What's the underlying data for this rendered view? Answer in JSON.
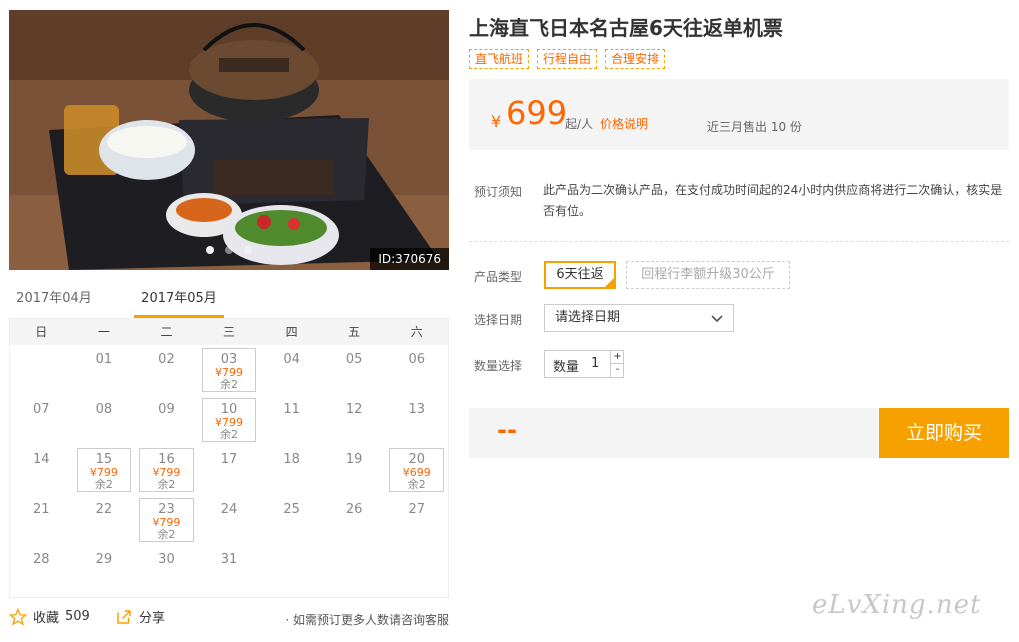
{
  "product": {
    "title": "上海直飞日本名古屋6天往返单机票",
    "tags": [
      "直飞航班",
      "行程自由",
      "合理安排"
    ],
    "photo_id": "ID:370676"
  },
  "price": {
    "currency": "¥",
    "amount": "699",
    "per": "起/人",
    "note_link": "价格说明",
    "sold": "近三月售出 10 份"
  },
  "booking": {
    "notice_label": "预订须知",
    "notice_text": "此产品为二次确认产品，在支付成功时间起的24小时内供应商将进行二次确认，核实是否有位。",
    "type_label": "产品类型",
    "type_selected": "6天往返",
    "type_alt": "回程行李额升级30公斤",
    "date_label": "选择日期",
    "date_placeholder": "请选择日期",
    "qty_label_row": "数量选择",
    "qty_label": "数量",
    "qty_value": "1",
    "qty_plus": "+",
    "qty_minus": "-"
  },
  "buy": {
    "total": "--",
    "button": "立即购买"
  },
  "calendar": {
    "tabs": [
      "2017年04月",
      "2017年05月"
    ],
    "active_tab": 1,
    "weekdays": [
      "日",
      "一",
      "二",
      "三",
      "四",
      "五",
      "六"
    ],
    "weeks": [
      [
        null,
        {
          "d": "01"
        },
        {
          "d": "02"
        },
        {
          "d": "03",
          "p": "¥799",
          "s": "余2"
        },
        {
          "d": "04"
        },
        {
          "d": "05"
        },
        {
          "d": "06"
        }
      ],
      [
        {
          "d": "07"
        },
        {
          "d": "08"
        },
        {
          "d": "09"
        },
        {
          "d": "10",
          "p": "¥799",
          "s": "余2"
        },
        {
          "d": "11"
        },
        {
          "d": "12"
        },
        {
          "d": "13"
        }
      ],
      [
        {
          "d": "14"
        },
        {
          "d": "15",
          "p": "¥799",
          "s": "余2"
        },
        {
          "d": "16",
          "p": "¥799",
          "s": "余2"
        },
        {
          "d": "17"
        },
        {
          "d": "18"
        },
        {
          "d": "19"
        },
        {
          "d": "20",
          "p": "¥699",
          "s": "余2"
        }
      ],
      [
        {
          "d": "21"
        },
        {
          "d": "22"
        },
        {
          "d": "23",
          "p": "¥799",
          "s": "余2"
        },
        {
          "d": "24"
        },
        {
          "d": "25"
        },
        {
          "d": "26"
        },
        {
          "d": "27"
        }
      ],
      [
        {
          "d": "28"
        },
        {
          "d": "29"
        },
        {
          "d": "30"
        },
        {
          "d": "31"
        },
        null,
        null,
        null
      ]
    ]
  },
  "footer": {
    "fav_label": "收藏",
    "fav_count": "509",
    "share_label": "分享",
    "hint": "· 如需预订更多人数请咨询客服"
  },
  "watermark": "eLvXing.net",
  "colors": {
    "accent": "#f7a100",
    "price": "#ff6600",
    "panel": "#f4f4f4"
  }
}
